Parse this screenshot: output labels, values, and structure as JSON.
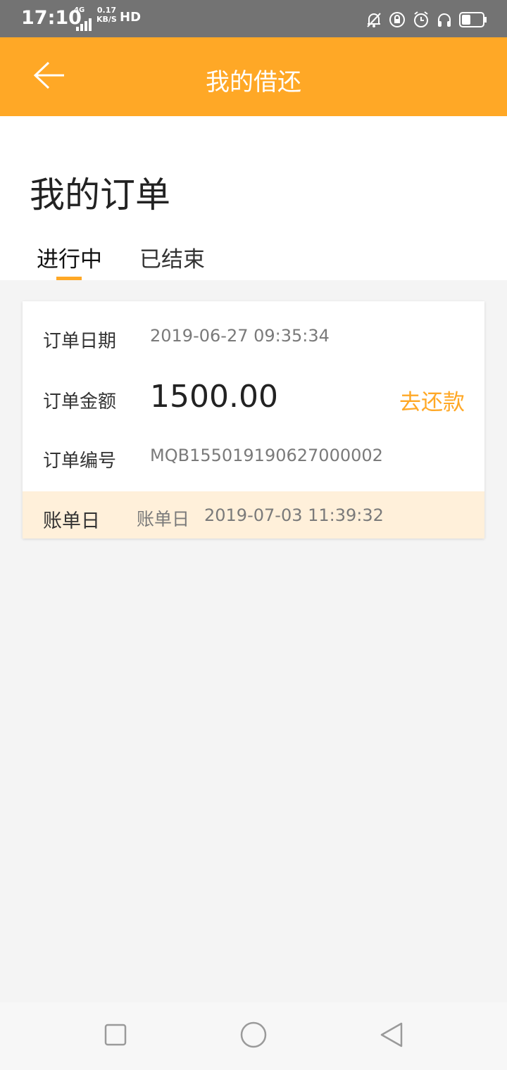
{
  "status_bar": {
    "time": "17:10",
    "network": "4G",
    "speed_value": "0.17",
    "speed_unit": "KB/S",
    "hd": "HD",
    "icons": [
      "bell-off-icon",
      "lock-rotation-icon",
      "alarm-icon",
      "headphones-icon",
      "battery-icon"
    ]
  },
  "app_bar": {
    "title": "我的借还",
    "back_icon": "arrow-left-icon"
  },
  "page": {
    "heading": "我的订单",
    "tabs": [
      {
        "label": "进行中",
        "active": true
      },
      {
        "label": "已结束",
        "active": false
      }
    ]
  },
  "order": {
    "date_label": "订单日期",
    "date_value": "2019-06-27 09:35:34",
    "amount_label": "订单金额",
    "amount_value": "1500.00",
    "repay_label": "去还款",
    "number_label": "订单编号",
    "number_value": "MQB155019190627000002",
    "bill": {
      "label": "账单日",
      "prefix": "账单日",
      "date": "2019-07-03 11:39:32"
    }
  },
  "nav_bar": {
    "buttons": [
      "recents-square-icon",
      "home-circle-icon",
      "back-triangle-icon"
    ]
  },
  "colors": {
    "accent": "#ffa826",
    "status_bar": "#737373",
    "bill_strip": "#fff0da"
  }
}
